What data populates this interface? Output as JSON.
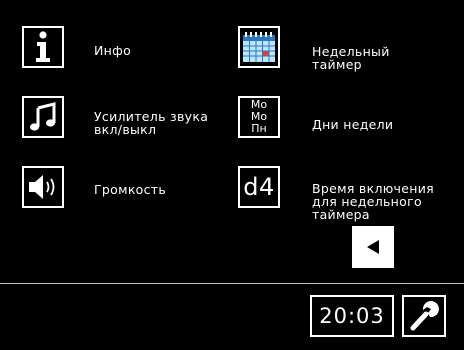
{
  "menu": {
    "info": {
      "label": "Инфо",
      "icon": "info-icon"
    },
    "weekly_timer": {
      "label": "Недельный\nтаймер",
      "icon": "calendar-icon"
    },
    "sound_amp": {
      "label": "Усилитель звука\nвкл/выкл",
      "icon": "music-note-icon"
    },
    "weekdays": {
      "label": "Дни недели",
      "icon": "weekdays-icon",
      "icon_lines": [
        "Мо",
        "Мо",
        "Пн"
      ]
    },
    "volume": {
      "label": "Громкость",
      "icon": "speaker-icon"
    },
    "start_time": {
      "label": "Время включения\nдля недельного\nтаймера",
      "icon_text": "d4"
    }
  },
  "footer": {
    "clock": "20:03",
    "settings_icon": "wrench-icon",
    "back_icon": "arrow-left-icon"
  }
}
